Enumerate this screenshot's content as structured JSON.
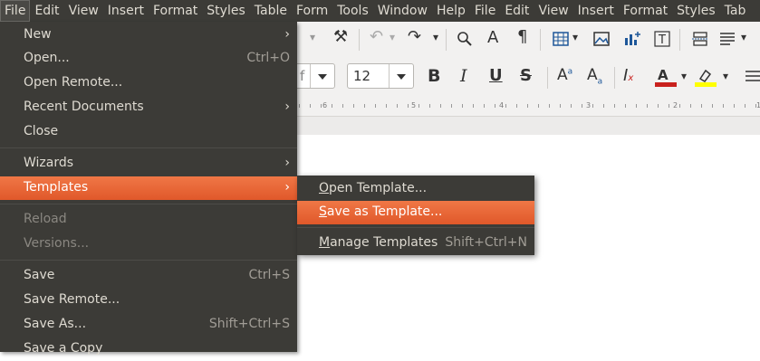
{
  "menubar": {
    "items": [
      "File",
      "Edit",
      "View",
      "Insert",
      "Format",
      "Styles",
      "Table",
      "Form",
      "Tools",
      "Window",
      "Help",
      "File",
      "Edit",
      "View",
      "Insert",
      "Format",
      "Styles",
      "Tab"
    ]
  },
  "toolbar": {
    "font_size": "12",
    "font_name_partial": "f"
  },
  "ruler": {
    "marks": [
      "6",
      "5",
      "4",
      "3",
      "2",
      "1"
    ]
  },
  "file_menu": {
    "items": [
      {
        "label": "New",
        "accel": "",
        "submenu": true
      },
      {
        "label": "Open...",
        "accel": "Ctrl+O"
      },
      {
        "label": "Open Remote...",
        "accel": ""
      },
      {
        "label": "Recent Documents",
        "accel": "",
        "submenu": true
      },
      {
        "label": "Close",
        "accel": ""
      },
      {
        "label": "Wizards",
        "accel": "",
        "submenu": true
      },
      {
        "label": "Templates",
        "accel": "",
        "submenu": true
      },
      {
        "label": "Reload",
        "accel": ""
      },
      {
        "label": "Versions...",
        "accel": ""
      },
      {
        "label": "Save",
        "accel": "Ctrl+S"
      },
      {
        "label": "Save Remote...",
        "accel": ""
      },
      {
        "label": "Save As...",
        "accel": "Shift+Ctrl+S"
      },
      {
        "label": "Save a Copy",
        "accel": ""
      }
    ]
  },
  "templates_submenu": {
    "items": [
      {
        "label_u": "O",
        "label_rest": "pen Template...",
        "accel": ""
      },
      {
        "label_u": "S",
        "label_rest": "ave as Template...",
        "accel": ""
      },
      {
        "label_u": "M",
        "label_rest": "anage Templates",
        "accel": "Shift+Ctrl+N"
      }
    ]
  },
  "colors": {
    "accent": "#e8652f",
    "menu_bg": "#3c3b37",
    "menu_text": "#dfdbd2",
    "font_color": "#c9211e",
    "highlight": "#ffff00"
  }
}
